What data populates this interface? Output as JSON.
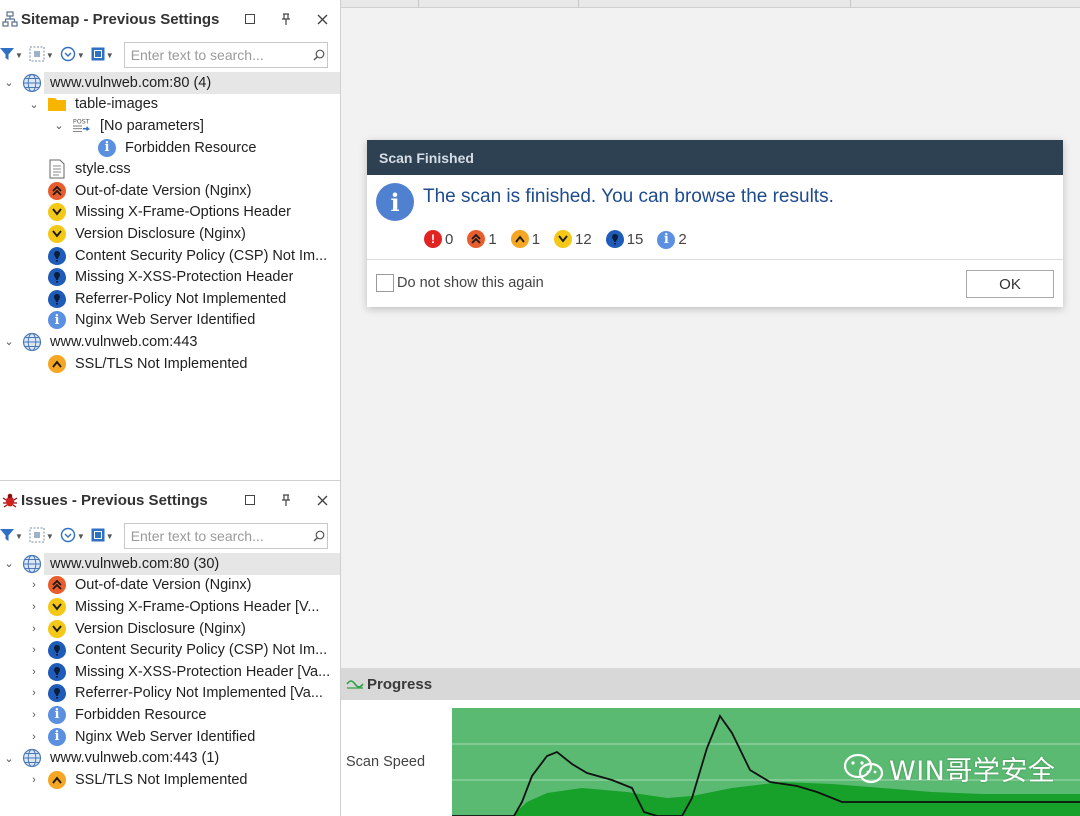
{
  "colors": {
    "high": "#e85d2d",
    "medium": "#f5a623",
    "low": "#f4c816",
    "information": "#5b8fe0",
    "critical": "#e02424",
    "best_practice": "#1f5bb8",
    "dialog_header": "#2e4153",
    "chart_light_green": "#5aba72",
    "chart_dark_green": "#17a02a"
  },
  "sitemap": {
    "title": "Sitemap - Previous Settings",
    "search_placeholder": "Enter text to search...",
    "tree": [
      {
        "label": "www.vulnweb.com:80 (4)",
        "icon": "globe-icon",
        "expanded": true,
        "selected": true
      },
      {
        "label": "table-images",
        "icon": "folder-icon",
        "expanded": true
      },
      {
        "label": "[No parameters]",
        "icon": "post-icon",
        "icon_text": "POST",
        "expanded": true
      },
      {
        "label": "Forbidden Resource",
        "icon": "info-icon"
      },
      {
        "label": "style.css",
        "icon": "file-icon"
      },
      {
        "label": "Out-of-date Version (Nginx)",
        "icon": "high-severity-icon"
      },
      {
        "label": "Missing X-Frame-Options Header",
        "icon": "low-severity-icon"
      },
      {
        "label": "Version Disclosure (Nginx)",
        "icon": "low-severity-icon"
      },
      {
        "label": "Content Security Policy (CSP) Not Im...",
        "icon": "best-practice-icon"
      },
      {
        "label": "Missing X-XSS-Protection Header",
        "icon": "best-practice-icon"
      },
      {
        "label": "Referrer-Policy Not Implemented",
        "icon": "best-practice-icon"
      },
      {
        "label": "Nginx Web Server Identified",
        "icon": "info-icon"
      },
      {
        "label": "www.vulnweb.com:443",
        "icon": "globe-icon",
        "expanded": true
      },
      {
        "label": "SSL/TLS Not Implemented",
        "icon": "medium-severity-icon"
      }
    ]
  },
  "issues": {
    "title": "Issues - Previous Settings",
    "search_placeholder": "Enter text to search...",
    "tree": [
      {
        "label": "www.vulnweb.com:80 (30)",
        "icon": "globe-icon",
        "expanded": true,
        "selected": true
      },
      {
        "label": "Out-of-date Version (Nginx)",
        "icon": "high-severity-icon"
      },
      {
        "label": "Missing X-Frame-Options Header [V...",
        "icon": "low-severity-icon"
      },
      {
        "label": "Version Disclosure (Nginx)",
        "icon": "low-severity-icon"
      },
      {
        "label": "Content Security Policy (CSP) Not Im...",
        "icon": "best-practice-icon"
      },
      {
        "label": "Missing X-XSS-Protection Header [Va...",
        "icon": "best-practice-icon"
      },
      {
        "label": "Referrer-Policy Not Implemented [Va...",
        "icon": "best-practice-icon"
      },
      {
        "label": "Forbidden Resource",
        "icon": "info-icon"
      },
      {
        "label": "Nginx Web Server Identified",
        "icon": "info-icon"
      },
      {
        "label": "www.vulnweb.com:443 (1)",
        "icon": "globe-icon",
        "expanded": true
      },
      {
        "label": "SSL/TLS Not Implemented",
        "icon": "medium-severity-icon"
      }
    ]
  },
  "dialog": {
    "title": "Scan Finished",
    "message": "The scan is finished. You can browse the results.",
    "counts": [
      {
        "severity": "critical",
        "icon": "critical-icon",
        "value": "0"
      },
      {
        "severity": "high",
        "icon": "high-severity-icon",
        "value": "1"
      },
      {
        "severity": "medium",
        "icon": "medium-severity-icon",
        "value": "1"
      },
      {
        "severity": "low",
        "icon": "low-severity-icon",
        "value": "12"
      },
      {
        "severity": "best_practice",
        "icon": "best-practice-icon",
        "value": "15"
      },
      {
        "severity": "information",
        "icon": "info-icon",
        "value": "2"
      }
    ],
    "checkbox_label": "Do not show this again",
    "checkbox_checked": false,
    "ok_label": "OK"
  },
  "progress": {
    "title": "Progress",
    "speed_label": "Scan Speed"
  },
  "watermark": {
    "text": "WIN哥学安全"
  }
}
